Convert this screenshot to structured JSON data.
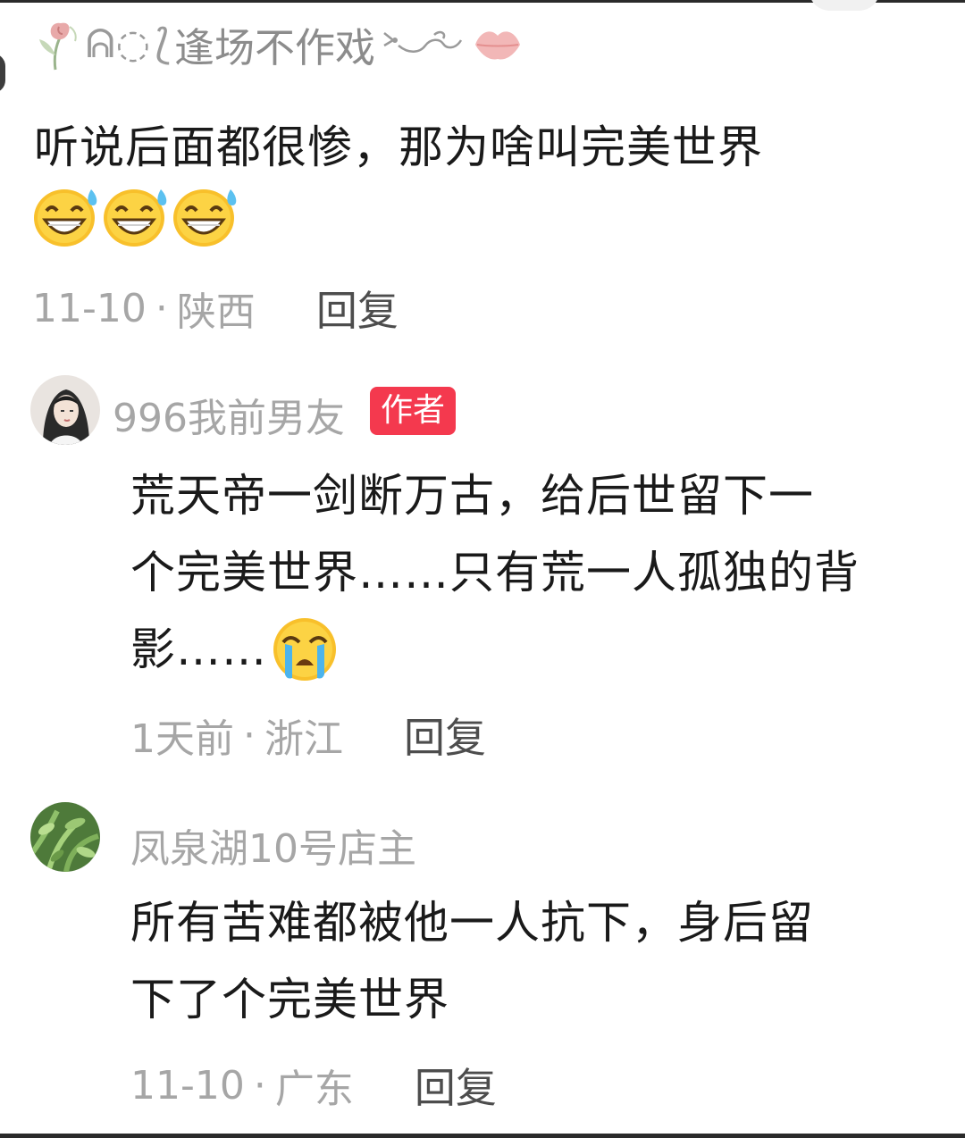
{
  "comments": [
    {
      "user": "逢场不作戏",
      "text": "听说后面都很惨，那为啥叫完美世界",
      "date": "11-10",
      "location": "陕西",
      "reply_label": "回复",
      "emoji_count": 3
    },
    {
      "user": "996我前男友",
      "badge": "作者",
      "text_line1": "荒天帝一剑断万古，给后世留下一",
      "text_line2": "个完美世界……只有荒一人孤独的背",
      "text_line3": "影……",
      "time": "1天前",
      "location": "浙江",
      "reply_label": "回复"
    },
    {
      "user": "凤泉湖10号店主",
      "text_line1": "所有苦难都被他一人抗下，身后留",
      "text_line2": "下了个完美世界",
      "date": "11-10",
      "location": "广东",
      "reply_label": "回复"
    }
  ],
  "meta_separator": "·",
  "colors": {
    "text": "#1a1a1a",
    "meta": "#a6a6a6",
    "reply": "#4d4d4d",
    "badge_bg": "#f4394e"
  },
  "icons": [
    "rose-icon",
    "ribbon-icon",
    "lips-icon",
    "grin-sweat-emoji",
    "crying-emoji",
    "avatar-portrait",
    "avatar-plant"
  ]
}
